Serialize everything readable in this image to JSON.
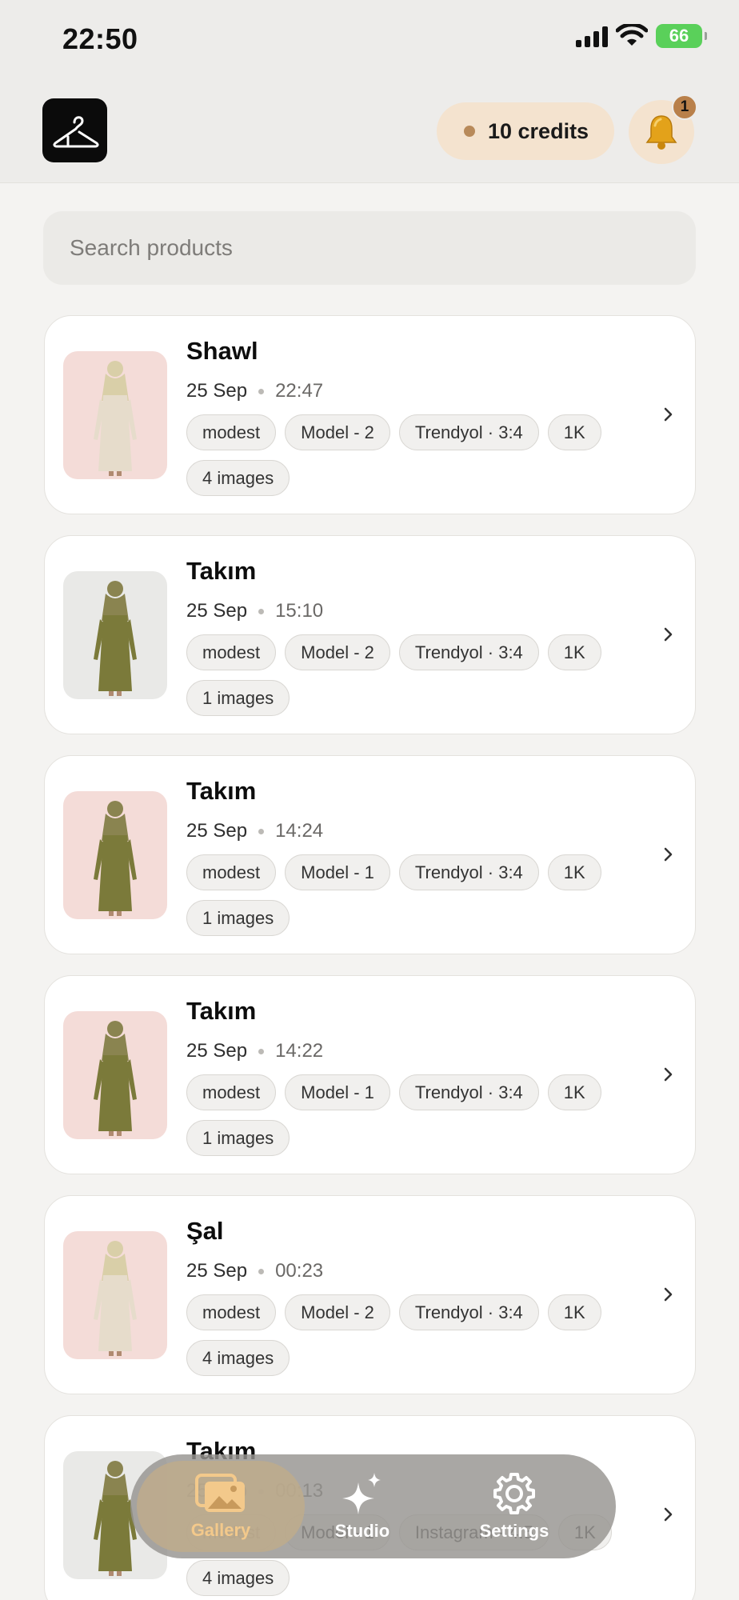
{
  "status_bar": {
    "time": "22:50",
    "battery": "66"
  },
  "header": {
    "credits_label": "10 credits",
    "notification_count": "1"
  },
  "search": {
    "placeholder": "Search products"
  },
  "products": [
    {
      "title": "Shawl",
      "date": "25 Sep",
      "time": "22:47",
      "tags": [
        "modest",
        "Model - 2",
        "Trendyol · 3:4",
        "1K",
        "4 images"
      ],
      "thumb": "pink"
    },
    {
      "title": "Takım",
      "date": "25 Sep",
      "time": "15:10",
      "tags": [
        "modest",
        "Model - 2",
        "Trendyol · 3:4",
        "1K",
        "1 images"
      ],
      "thumb": "grey"
    },
    {
      "title": "Takım",
      "date": "25 Sep",
      "time": "14:24",
      "tags": [
        "modest",
        "Model - 1",
        "Trendyol · 3:4",
        "1K",
        "1 images"
      ],
      "thumb": "pink"
    },
    {
      "title": "Takım",
      "date": "25 Sep",
      "time": "14:22",
      "tags": [
        "modest",
        "Model - 1",
        "Trendyol · 3:4",
        "1K",
        "1 images"
      ],
      "thumb": "pink"
    },
    {
      "title": "Şal",
      "date": "25 Sep",
      "time": "00:23",
      "tags": [
        "modest",
        "Model - 2",
        "Trendyol · 3:4",
        "1K",
        "4 images"
      ],
      "thumb": "pink"
    },
    {
      "title": "Takım",
      "date": "25 Sep",
      "time": "00:13",
      "tags": [
        "modest",
        "Model - 1",
        "Instagram · 4:5",
        "1K",
        "4 images"
      ],
      "thumb": "grey"
    }
  ],
  "nav": {
    "gallery": "Gallery",
    "studio": "Studio",
    "settings": "Settings"
  },
  "colors": {
    "accent": "#f3c98b",
    "credits_bg": "#f4e3cf"
  }
}
